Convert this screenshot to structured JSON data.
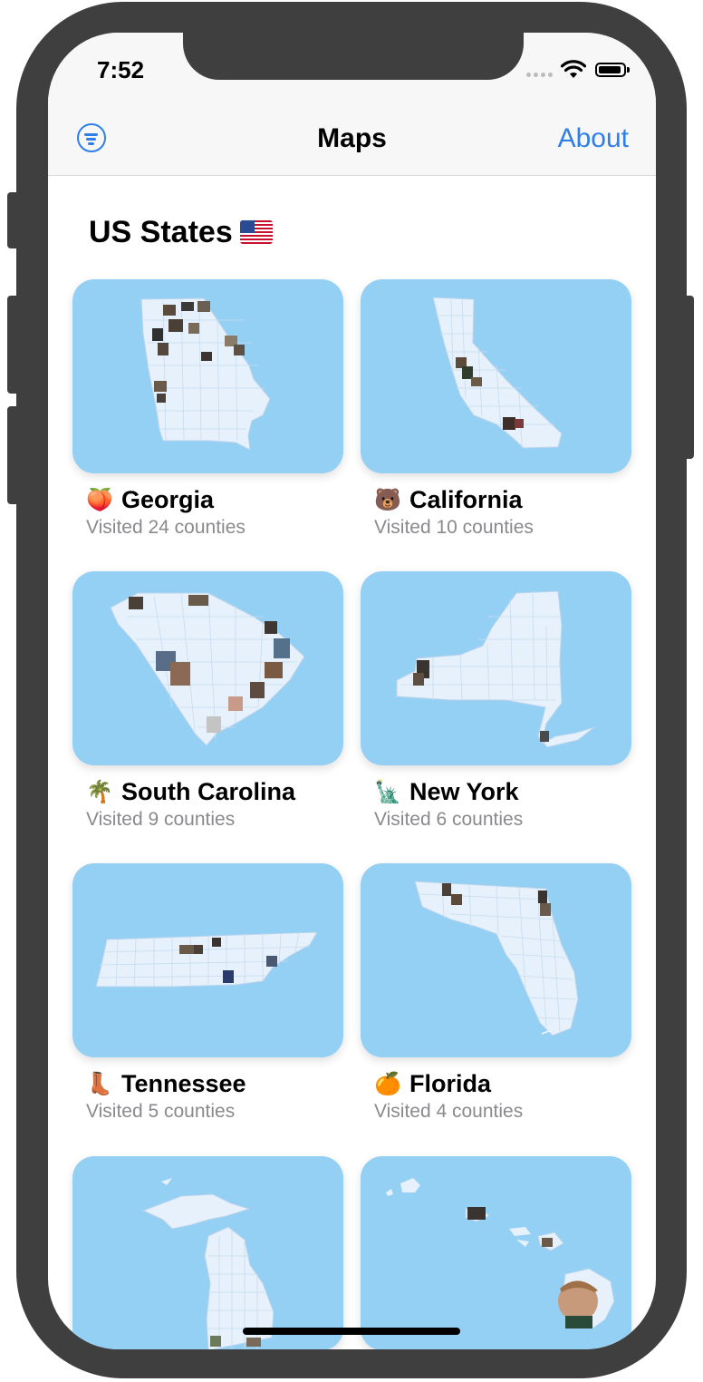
{
  "status": {
    "time": "7:52"
  },
  "nav": {
    "title": "Maps",
    "about_label": "About",
    "filter_icon": "line-3-horizontal-decrease-circle-icon"
  },
  "section": {
    "title": "US States",
    "flag": "us-flag-icon"
  },
  "colors": {
    "accent": "#2f7fe8",
    "card_bg": "#94cff4",
    "map_fill": "#e6f1fb",
    "secondary_text": "#8a8a8e"
  },
  "states": [
    {
      "name": "Georgia",
      "emoji": "🍑",
      "visited": "Visited 24 counties"
    },
    {
      "name": "California",
      "emoji": "🐻",
      "visited": "Visited 10 counties"
    },
    {
      "name": "South Carolina",
      "emoji": "🌴",
      "visited": "Visited 9 counties"
    },
    {
      "name": "New York",
      "emoji": "🗽",
      "visited": "Visited 6 counties"
    },
    {
      "name": "Tennessee",
      "emoji": "👢",
      "visited": "Visited 5 counties"
    },
    {
      "name": "Florida",
      "emoji": "🍊",
      "visited": "Visited 4 counties"
    },
    {
      "name": "",
      "emoji": "",
      "visited": ""
    },
    {
      "name": "",
      "emoji": "",
      "visited": ""
    }
  ]
}
